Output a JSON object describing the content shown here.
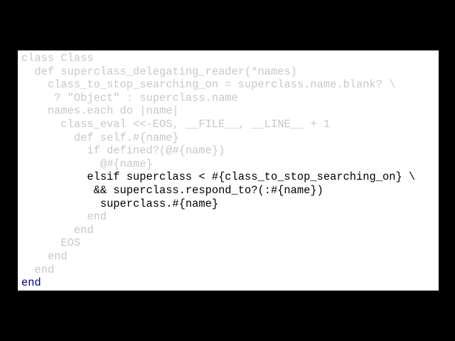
{
  "slide": {
    "background_color": "#000000",
    "panel_color": "#ffffff",
    "colors": {
      "dimmed_text": "#c8c8c8",
      "highlighted_text": "#000000",
      "final_end": "#000080"
    },
    "code_lines": [
      {
        "text": "class Class",
        "style": "dim"
      },
      {
        "text": "  def superclass_delegating_reader(*names)",
        "style": "dim"
      },
      {
        "text": "    class_to_stop_searching_on = superclass.name.blank? \\",
        "style": "dim"
      },
      {
        "text": "     ? \"Object\" : superclass.name",
        "style": "dim"
      },
      {
        "text": "    names.each do |name|",
        "style": "dim"
      },
      {
        "text": "      class_eval <<-EOS, __FILE__, __LINE__ + 1",
        "style": "dim"
      },
      {
        "text": "        def self.#{name}",
        "style": "dim"
      },
      {
        "text": "          if defined?(@#{name})",
        "style": "dim"
      },
      {
        "text": "            @#{name}",
        "style": "dim"
      },
      {
        "text": "          elsif superclass < #{class_to_stop_searching_on} \\",
        "style": "hi"
      },
      {
        "text": "           && superclass.respond_to?(:#{name})",
        "style": "hi"
      },
      {
        "text": "            superclass.#{name}",
        "style": "hi"
      },
      {
        "text": "          end",
        "style": "dim"
      },
      {
        "text": "        end",
        "style": "dim"
      },
      {
        "text": "      EOS",
        "style": "dim"
      },
      {
        "text": "    end",
        "style": "dim"
      },
      {
        "text": "  end",
        "style": "dim"
      },
      {
        "text": "end",
        "style": "end-line"
      }
    ]
  }
}
